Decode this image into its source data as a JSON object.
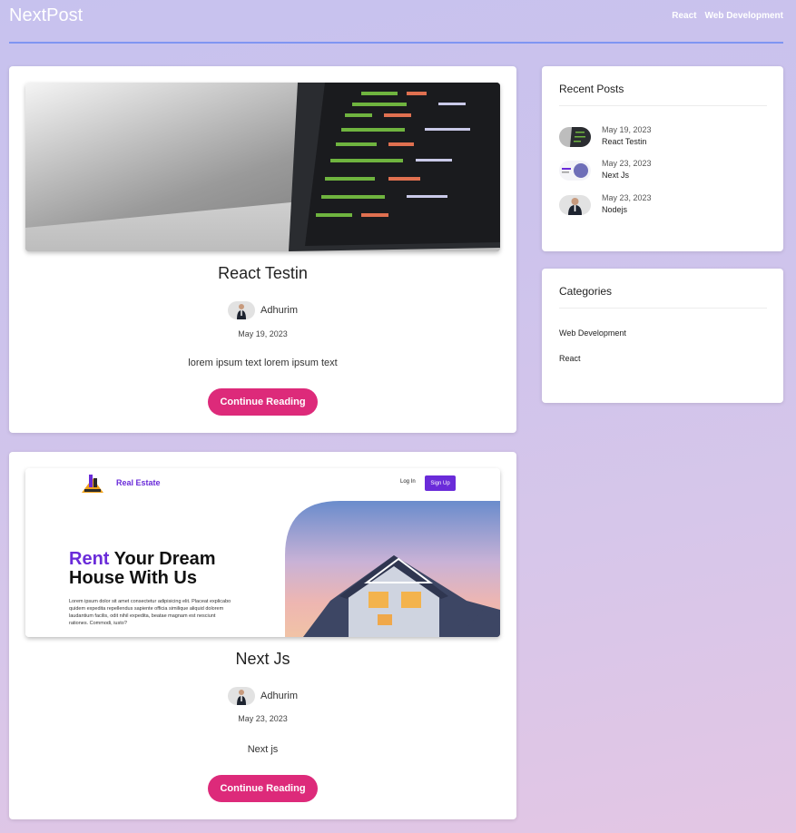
{
  "header": {
    "logo": "NextPost",
    "nav": [
      "React",
      "Web Development"
    ]
  },
  "posts": [
    {
      "title": "React Testin",
      "author": "Adhurim",
      "date": "May 19, 2023",
      "excerpt": "lorem ipsum text lorem ipsum text",
      "button": "Continue Reading"
    },
    {
      "title": "Next Js",
      "author": "Adhurim",
      "date": "May 23, 2023",
      "excerpt": "Next js",
      "button": "Continue Reading",
      "hero": {
        "brand": "Real Estate",
        "login": "Log In",
        "signup": "Sign Up",
        "headline_accent": "Rent",
        "headline_rest": " Your Dream",
        "headline_line2": "House With Us",
        "body": "Lorem ipsum dolor sit amet consectetur adipisicing elit. Placeat explicabo quidem expedita repellendus sapiente officia similique aliquid dolorem laudantium facilis, odit nihil expedita, beatae magnam est nesciunt rationes. Commodi, iusto?"
      }
    }
  ],
  "sidebar": {
    "recent_title": "Recent Posts",
    "recent": [
      {
        "date": "May 19, 2023",
        "title": "React Testin"
      },
      {
        "date": "May 23, 2023",
        "title": "Next Js"
      },
      {
        "date": "May 23, 2023",
        "title": "Nodejs"
      }
    ],
    "categories_title": "Categories",
    "categories": [
      "Web Development",
      "React"
    ]
  },
  "colors": {
    "accent": "#dd2a7a",
    "header_rule": "#7f95f2",
    "hero_purple": "#6a2bd9"
  }
}
